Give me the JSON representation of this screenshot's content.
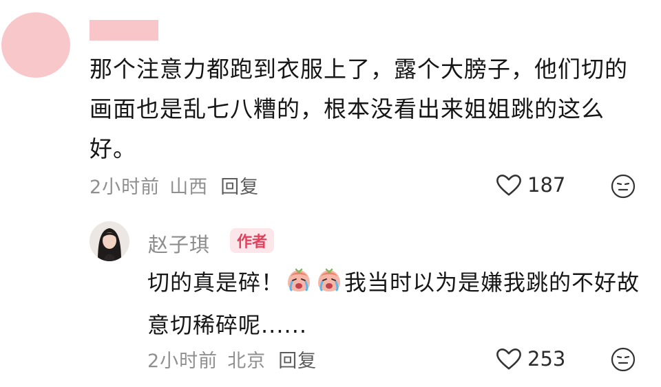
{
  "comment": {
    "text": "那个注意力都跑到衣服上了，露个大膀子，他们切的画面也是乱七八糟的，根本没看出来姐姐跳的这么好。",
    "time": "2小时前",
    "location": "山西",
    "reply_label": "回复",
    "likes": "187",
    "heart_icon": "heart-outline-icon",
    "emoji_icon": "smiley-neutral-icon"
  },
  "reply": {
    "author": "赵子琪",
    "badge": "作者",
    "text_before": "切的真是碎！",
    "emojis": [
      "crying-face-emoji",
      "crying-face-emoji"
    ],
    "text_after": "我当时以为是嫌我跳的不好故意切稀碎呢......",
    "time": "2小时前",
    "location": "北京",
    "reply_label": "回复",
    "likes": "253"
  },
  "colors": {
    "avatar_placeholder": "#f7c7c9",
    "badge_bg": "#fde6ea",
    "badge_text": "#e0425d",
    "meta_text": "#8f8f8f"
  }
}
